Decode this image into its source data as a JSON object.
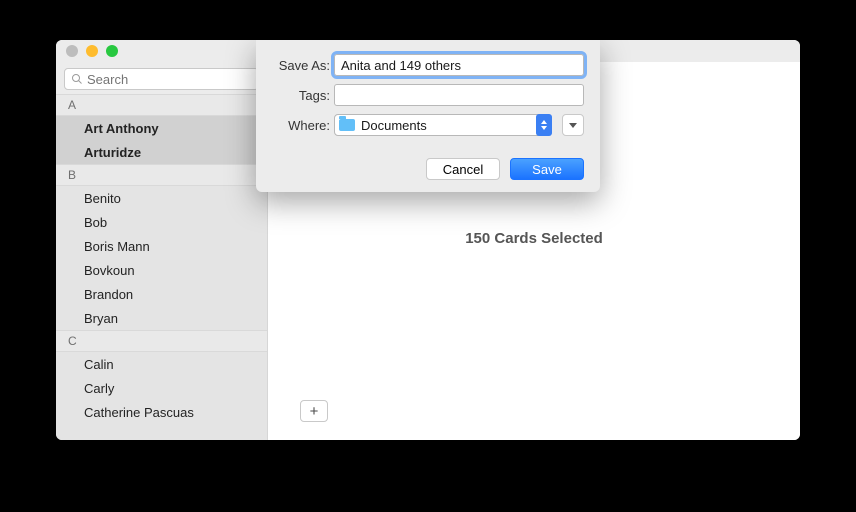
{
  "search": {
    "placeholder": "Search"
  },
  "sections": {
    "A": {
      "head": "A",
      "items": [
        "Art Anthony",
        "Arturidze"
      ]
    },
    "B": {
      "head": "B",
      "items": [
        "Benito",
        "Bob",
        "Boris Mann",
        "Bovkoun",
        "Brandon",
        "Bryan"
      ]
    },
    "C": {
      "head": "C",
      "items": [
        "Calin",
        "Carly",
        "Catherine Pascuas"
      ]
    }
  },
  "main": {
    "status": "150 Cards Selected",
    "add_glyph": "+"
  },
  "sheet": {
    "save_as_label": "Save As:",
    "save_as_value": "Anita and 149 others",
    "tags_label": "Tags:",
    "tags_value": "",
    "where_label": "Where:",
    "where_value": "Documents",
    "cancel": "Cancel",
    "save": "Save"
  }
}
